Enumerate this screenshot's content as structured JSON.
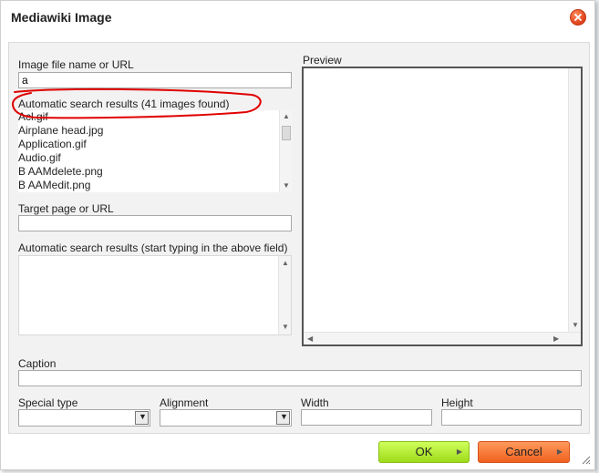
{
  "dialog": {
    "title": "Mediawiki Image",
    "close_icon": "close-icon"
  },
  "image_file": {
    "label": "Image file name or URL",
    "value": "a"
  },
  "image_results": {
    "label": "Automatic search results (41 images found)",
    "items": [
      "Acl.gif",
      "Airplane head.jpg",
      "Application.gif",
      "Audio.gif",
      "B AAMdelete.png",
      "B AAMedit.png"
    ]
  },
  "target_page": {
    "label": "Target page or URL",
    "value": ""
  },
  "page_results": {
    "label": "Automatic search results (start typing in the above field)"
  },
  "preview": {
    "label": "Preview"
  },
  "caption": {
    "label": "Caption",
    "value": ""
  },
  "special_type": {
    "label": "Special type",
    "selected": ""
  },
  "alignment": {
    "label": "Alignment",
    "selected": ""
  },
  "width": {
    "label": "Width",
    "value": ""
  },
  "height": {
    "label": "Height",
    "value": ""
  },
  "buttons": {
    "ok_label": "OK",
    "cancel_label": "Cancel"
  },
  "colors": {
    "ok_green": "#9edb1a",
    "cancel_orange": "#f0601e",
    "annotation_red": "#e00000"
  }
}
